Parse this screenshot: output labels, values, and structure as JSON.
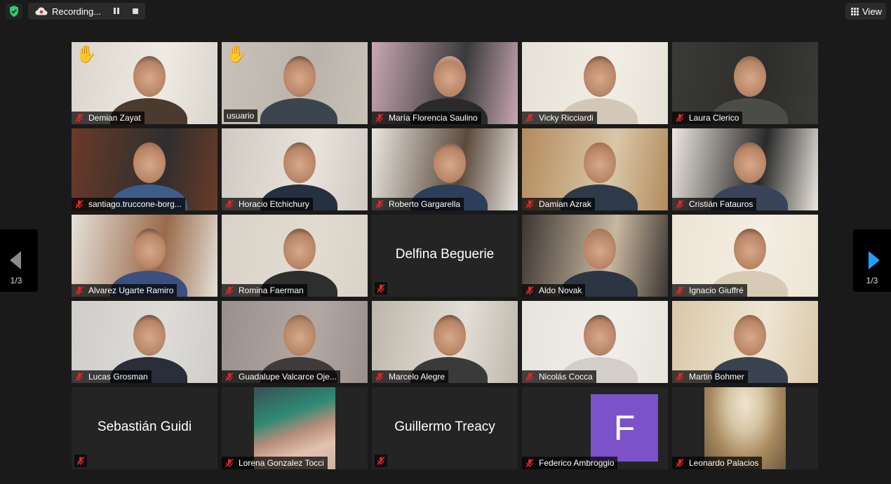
{
  "top_bar": {
    "recording_label": "Recording...",
    "view_label": "View"
  },
  "navigation": {
    "prev_page": "1/3",
    "next_page": "1/3"
  },
  "colors": {
    "active_speaker_border": "#c9e54a",
    "next_arrow": "#1ea0ff",
    "muted_mic": "#e0282e",
    "avatar_letter_bg": "#7b52c9",
    "shield": "#2ecc71"
  },
  "participants": [
    {
      "name": "Demian Zayat",
      "hand_raised": true
    },
    {
      "name": "usuario",
      "hand_raised": true,
      "active_speaker": true
    },
    {
      "name": "María Florencia Saulino"
    },
    {
      "name": "Vicky Ricciardi"
    },
    {
      "name": "Laura Clerico"
    },
    {
      "name": "santiago.truccone-borg..."
    },
    {
      "name": "Horacio Etchichury"
    },
    {
      "name": "Roberto Gargarella"
    },
    {
      "name": "Damian Azrak"
    },
    {
      "name": "Cristián Fatauros"
    },
    {
      "name": "Alvarez Ugarte Ramiro"
    },
    {
      "name": "Romina Faerman"
    },
    {
      "name": "Delfina Beguerie",
      "video_off": true
    },
    {
      "name": "Aldo Novak"
    },
    {
      "name": "Ignacio Giuffré"
    },
    {
      "name": "Lucas Grosman"
    },
    {
      "name": "Guadalupe Valcarce Oje..."
    },
    {
      "name": "Marcelo Alegre"
    },
    {
      "name": "Nicolás Cocca"
    },
    {
      "name": "Martin Bohmer"
    },
    {
      "name": "Sebastián Guidi",
      "video_off": true
    },
    {
      "name": "Lorena Gonzalez Tocci",
      "avatar": "photo"
    },
    {
      "name": "Guillermo Treacy",
      "video_off": true
    },
    {
      "name": "Federico Ambroggio",
      "avatar": "letter",
      "avatar_letter": "F"
    },
    {
      "name": "Leonardo Palacios",
      "avatar": "painting"
    }
  ]
}
